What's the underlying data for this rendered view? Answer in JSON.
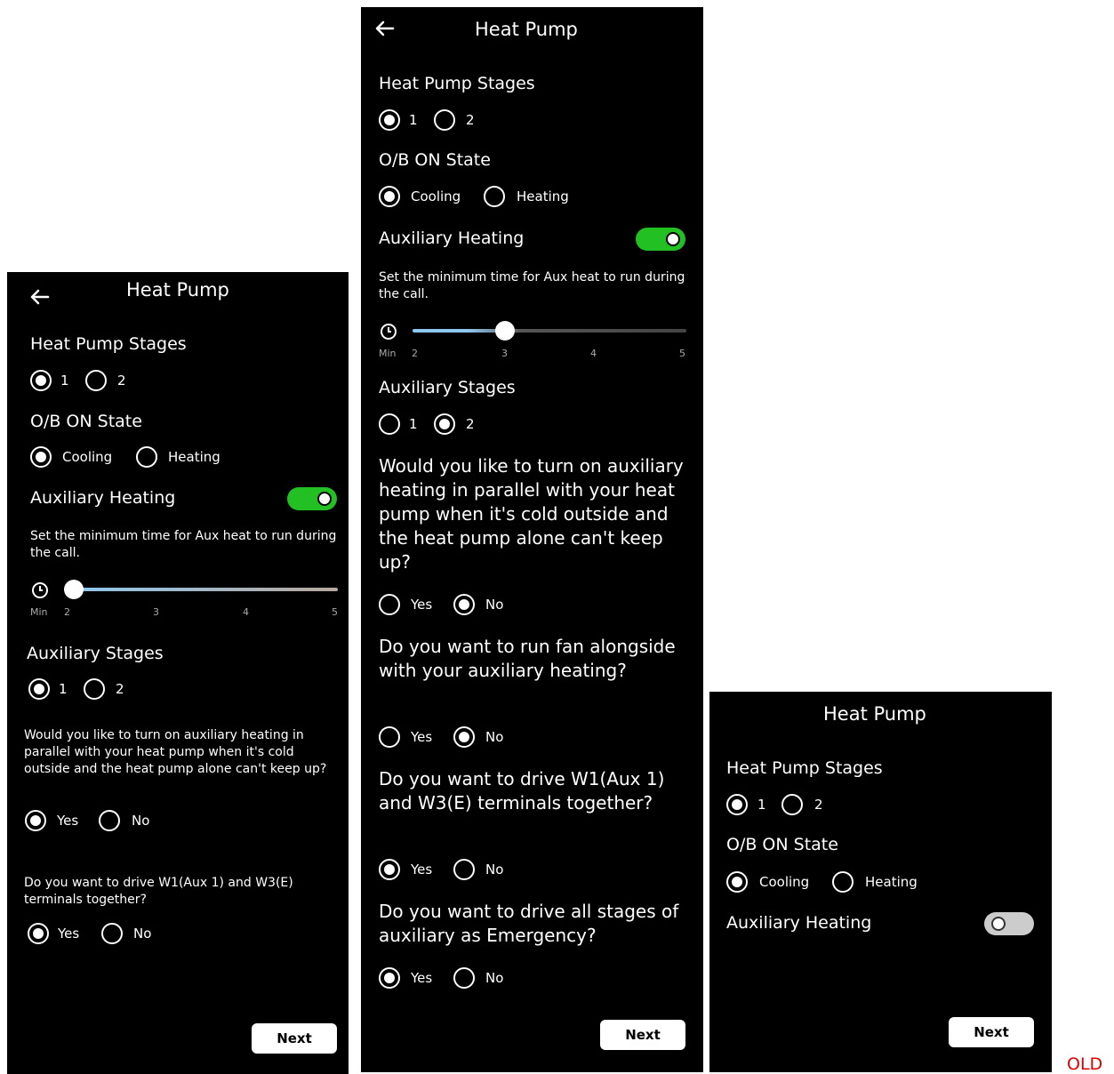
{
  "screens": [
    {
      "title": "Heat Pump",
      "stages_label": "Heat Pump Stages",
      "stage_1": "1",
      "stage_2": "2",
      "ob_label": "O/B ON State",
      "cooling": "Cooling",
      "heating": "Heating",
      "aux_label": "Auxiliary Heating",
      "aux_desc": "Set the minimum time for Aux heat to run during the call.",
      "slider": {
        "min_label": "Min",
        "ticks": [
          "2",
          "3",
          "4",
          "5"
        ],
        "value": 2
      },
      "aux_stages_label": "Auxiliary Stages",
      "aux_stage_1": "1",
      "aux_stage_2": "2",
      "q1": "Would you like to turn on auxiliary heating in parallel with your heat pump when it's cold outside and the heat pump alone can't keep up?",
      "q1_yes": "Yes",
      "q1_no": "No",
      "q2": "Do you want to drive W1(Aux 1) and W3(E) terminals together?",
      "q2_yes": "Yes",
      "q2_no": "No",
      "next": "Next"
    },
    {
      "title": "Heat Pump",
      "stages_label": "Heat Pump Stages",
      "stage_1": "1",
      "stage_2": "2",
      "ob_label": "O/B ON State",
      "cooling": "Cooling",
      "heating": "Heating",
      "aux_label": "Auxiliary Heating",
      "aux_desc": "Set the minimum time for Aux heat to run during the call.",
      "slider": {
        "min_label": "Min",
        "ticks": [
          "2",
          "3",
          "4",
          "5"
        ],
        "value": 3
      },
      "aux_stages_label": "Auxiliary Stages",
      "aux_stage_1": "1",
      "aux_stage_2": "2",
      "q1": "Would you like to turn on auxiliary heating in parallel with your heat pump when it's cold outside and the heat pump alone can't keep up?",
      "q1_yes": "Yes",
      "q1_no": "No",
      "q2": "Do you want to run fan alongside with your auxiliary heating?",
      "q2_yes": "Yes",
      "q2_no": "No",
      "q3": "Do you want to drive W1(Aux 1) and W3(E) terminals together?",
      "q3_yes": "Yes",
      "q3_no": "No",
      "q4": "Do you want to drive all stages of auxiliary as Emergency?",
      "q4_yes": "Yes",
      "q4_no": "No",
      "next": "Next"
    },
    {
      "title": "Heat Pump",
      "stages_label": "Heat Pump Stages",
      "stage_1": "1",
      "stage_2": "2",
      "ob_label": "O/B ON State",
      "cooling": "Cooling",
      "heating": "Heating",
      "aux_label": "Auxiliary Heating",
      "next": "Next"
    }
  ],
  "old_label": "OLD",
  "colors": {
    "toggle_on": "#22c022",
    "toggle_off": "#cccccc",
    "annotation": "#e00000"
  },
  "icons": [
    "back-arrow-icon",
    "clock-icon"
  ]
}
